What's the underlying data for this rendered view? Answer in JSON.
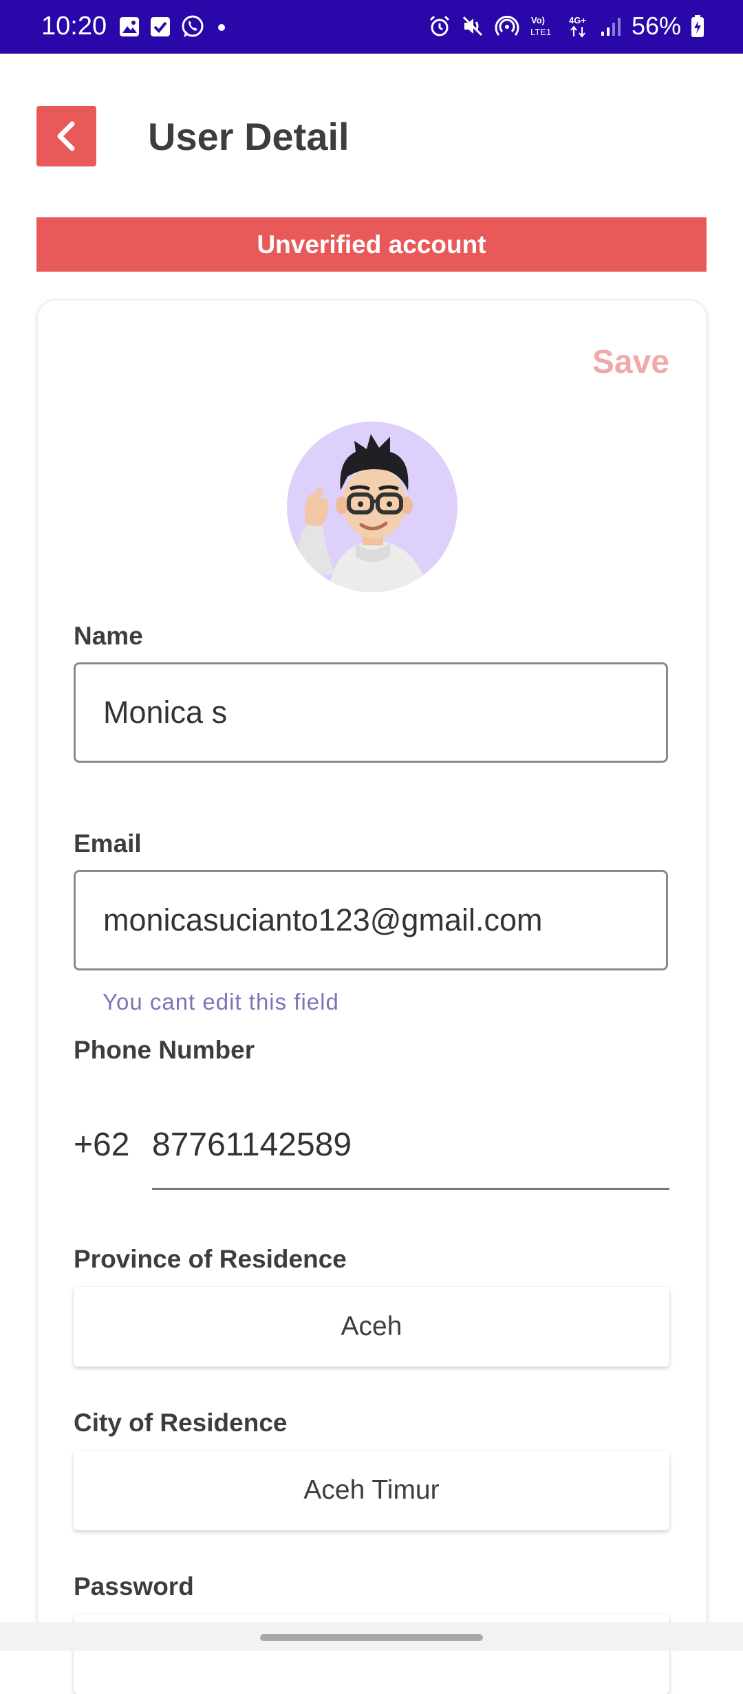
{
  "status_bar": {
    "time": "10:20",
    "battery_percent": "56%",
    "left_icons": [
      "gallery-icon",
      "checkbox-icon",
      "whatsapp-icon",
      "dot-icon"
    ],
    "right_icons": [
      "alarm-icon",
      "mute-icon",
      "hotspot-icon",
      "volte-icon",
      "4g-icon",
      "signal-icon",
      "battery-icon"
    ],
    "volte_label": "Vo) LTE1",
    "network_label": "4G+",
    "background_color": "#2a07a8"
  },
  "header": {
    "title": "User Detail",
    "back_icon": "chevron-left-icon",
    "accent_color": "#e85a5a"
  },
  "banner": {
    "text": "Unverified account"
  },
  "form": {
    "save_label": "Save",
    "name": {
      "label": "Name",
      "value": "Monica s"
    },
    "email": {
      "label": "Email",
      "value": "monicasucianto123@gmail.com",
      "helper": "You cant edit this field"
    },
    "phone": {
      "label": "Phone Number",
      "prefix": "+62",
      "value": "87761142589"
    },
    "province": {
      "label": "Province of Residence",
      "value": "Aceh"
    },
    "city": {
      "label": "City of Residence",
      "value": "Aceh Timur"
    },
    "password": {
      "label": "Password"
    }
  }
}
